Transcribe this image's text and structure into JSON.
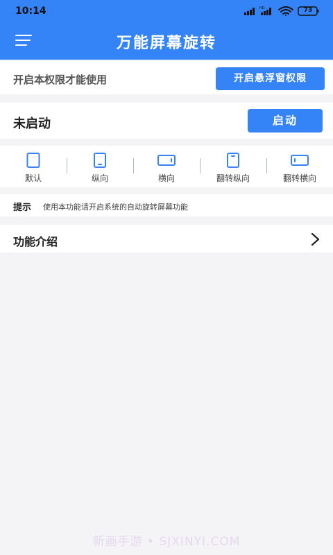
{
  "status_bar": {
    "time": "10:14",
    "battery_level": "73",
    "icons": [
      "signal-icon",
      "signal-hd-icon",
      "wifi-icon",
      "battery-icon"
    ]
  },
  "header": {
    "title": "万能屏幕旋转",
    "menu_icon": "menu-icon"
  },
  "permission": {
    "message": "开启本权限才能使用",
    "button_label": "开启悬浮窗权限"
  },
  "service": {
    "status": "未启动",
    "button_label": "启动"
  },
  "modes": [
    {
      "label": "默认",
      "icon": "tablet-default-icon"
    },
    {
      "label": "纵向",
      "icon": "phone-portrait-icon"
    },
    {
      "label": "横向",
      "icon": "phone-landscape-icon"
    },
    {
      "label": "翻转纵向",
      "icon": "phone-portrait-reverse-icon"
    },
    {
      "label": "翻转横向",
      "icon": "phone-landscape-reverse-icon"
    }
  ],
  "tip": {
    "title": "提示",
    "text": "使用本功能请开启系统的自动旋转屏幕功能"
  },
  "intro": {
    "label": "功能介绍",
    "icon": "chevron-right-icon"
  },
  "watermark": "新画手游 • SJXINYI.COM",
  "colors": {
    "accent": "#3484f7",
    "background": "#f4f4f6"
  }
}
